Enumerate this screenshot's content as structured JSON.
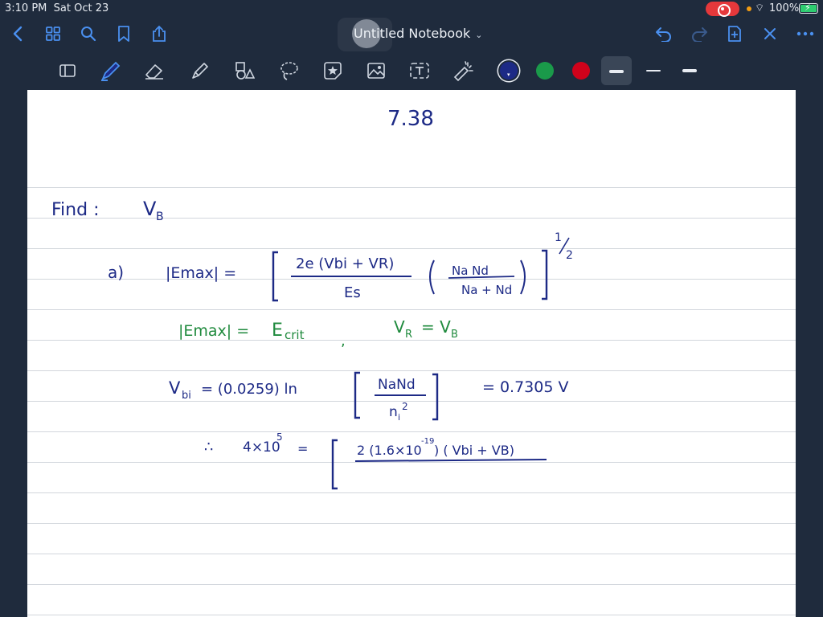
{
  "status": {
    "time": "3:10 PM",
    "date": "Sat Oct 23",
    "battery": "100%"
  },
  "nav": {
    "title": "Untitled Notebook",
    "icons": [
      "chevron-left-icon",
      "grid-icon",
      "search-icon",
      "bookmark-icon",
      "share-icon",
      "undo-icon",
      "redo-icon",
      "add-page-icon",
      "close-icon",
      "more-icon"
    ]
  },
  "toolbar": {
    "tools": [
      "page-layout-icon",
      "pen-icon",
      "eraser-icon",
      "highlighter-icon",
      "shapes-icon",
      "lasso-icon",
      "sticker-icon",
      "image-icon",
      "text-icon",
      "laser-pointer-icon"
    ],
    "colors": [
      "#1d2a86",
      "#1a9a4a",
      "#d0021b"
    ],
    "active_color": "#1d2a86"
  },
  "note": {
    "problem": "7.38",
    "find_label": "Find :",
    "find_var": "V",
    "find_sub": "B",
    "part_a": "a)",
    "emax": "|Emax| =",
    "eq1_num": "2e (Vbi + VR)",
    "eq1_den": "Es",
    "frac2_num": "Na Nd",
    "frac2_den": "Na + Nd",
    "exp_half_num": "1",
    "exp_half_den": "2",
    "green_line_1": "|Emax| =",
    "green_ecrit": "E",
    "green_ecrit_sub": "crit",
    "green_comma": ",",
    "green_vr": "V",
    "green_vr_sub": "R",
    "green_eq": "= V",
    "green_vb_sub": "B",
    "vbi": "V",
    "vbi_sub": "bi",
    "vbi_expr": "= (0.0259) ln",
    "vbi_frac_num": "NaNd",
    "vbi_frac_den": "n",
    "vbi_frac_den_sub": "i",
    "vbi_frac_den_sup": "2",
    "vbi_result": "= 0.7305 V",
    "therefore": "∴",
    "lhs": "4×10",
    "lhs_sup": "5",
    "lhs_eq": "=",
    "rhs_num": "2 (1.6×10",
    "rhs_num_sup": "-19",
    "rhs_num_end": ") ( Vbi + VB)"
  }
}
